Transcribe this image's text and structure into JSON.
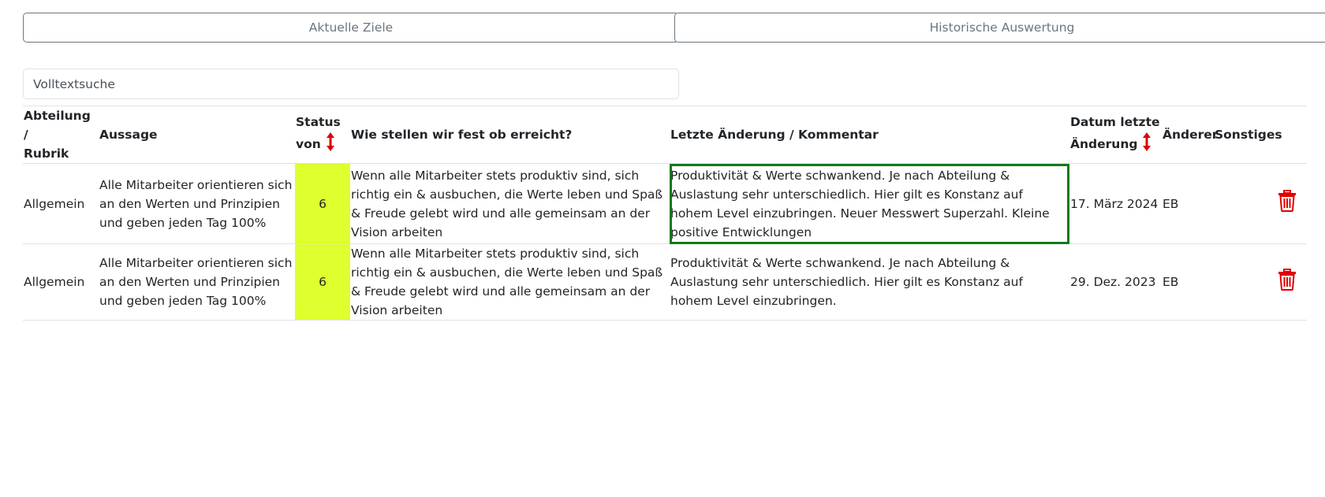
{
  "buttons": {
    "current_goals": "Aktuelle Ziele",
    "historical_eval": "Historische Auswertung"
  },
  "search": {
    "placeholder": "Volltextsuche",
    "value": ""
  },
  "table": {
    "headers": {
      "department_line1": "Abteilung /",
      "department_line2": "Rubrik",
      "statement": "Aussage",
      "status_line1": "Status",
      "status_line2": "von",
      "how_measured": "Wie stellen wir fest ob erreicht?",
      "last_change": "Letzte Änderung / Kommentar",
      "date_line1": "Datum letzte",
      "date_line2": "Änderung",
      "changer": "Änderer",
      "misc": "Sonstiges"
    },
    "rows": [
      {
        "department": "Allgemein",
        "statement": "Alle Mitarbeiter orientieren sich an den Werten und Prinzipien und geben jeden Tag 100%",
        "status": "6",
        "how_measured": "Wenn alle Mitarbeiter stets produktiv sind, sich richtig ein & ausbuchen, die Werte leben und Spaß & Freude gelebt wird und alle gemeinsam an der Vision arbeiten",
        "comment": "Produktivität & Werte schwankend. Je nach Abteilung & Auslastung sehr unterschiedlich. Hier gilt es Konstanz auf hohem Level einzubringen. Neuer Messwert Superzahl. Kleine positive Entwicklungen",
        "date": "17. März 2024",
        "changer": "EB"
      },
      {
        "department": "Allgemein",
        "statement": "Alle Mitarbeiter orientieren sich an den Werten und Prinzipien und geben jeden Tag 100%",
        "status": "6",
        "how_measured": "Wenn alle Mitarbeiter stets produktiv sind, sich richtig ein & ausbuchen, die Werte leben und Spaß & Freude gelebt wird und alle gemeinsam an der Vision arbeiten",
        "comment": "Produktivität & Werte schwankend. Je nach Abteilung & Auslastung sehr unterschiedlich. Hier gilt es Konstanz auf hohem Level einzubringen.",
        "date": "29. Dez. 2023",
        "changer": "EB"
      }
    ]
  },
  "colors": {
    "status_bg": "#dfff2f",
    "sort_arrow": "#e00000",
    "trash": "#e00000",
    "highlight_border": "#0f7a1c"
  },
  "icons": {
    "sort": "sort-updown-icon",
    "delete": "trash-icon"
  }
}
